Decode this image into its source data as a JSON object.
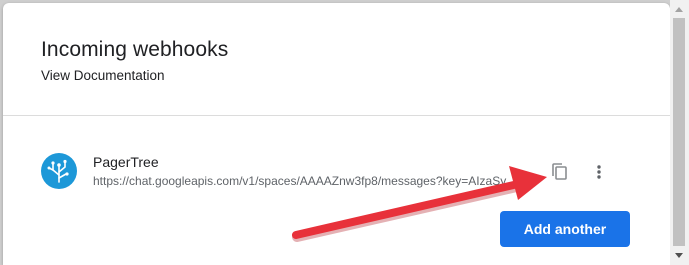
{
  "dialog": {
    "title": "Incoming webhooks",
    "doc_link": "View Documentation"
  },
  "webhook": {
    "name": "PagerTree",
    "url": "https://chat.googleapis.com/v1/spaces/AAAAZnw3fp8/messages?key=AIzaSy",
    "avatar_icon": "pagertree-logo-icon",
    "avatar_color": "#1d98d8"
  },
  "actions": {
    "copy_icon": "copy-icon",
    "more_icon": "more-vertical-icon",
    "add_label": "Add another"
  },
  "colors": {
    "primary": "#1a73e8",
    "annotation_arrow": "#e8313a"
  }
}
